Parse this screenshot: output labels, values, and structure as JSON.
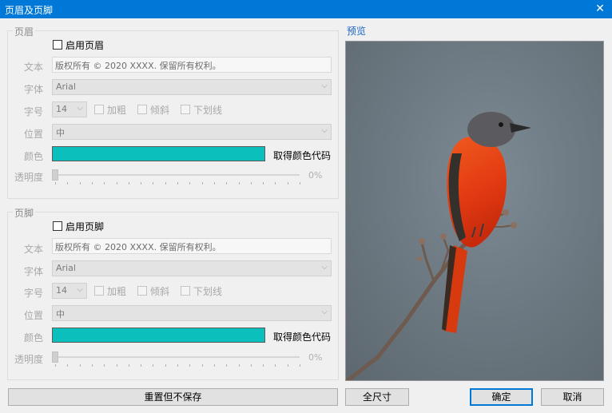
{
  "window": {
    "title": "页眉及页脚",
    "close_glyph": "✕"
  },
  "header": {
    "group_title": "页眉",
    "enable_label": "启用页眉",
    "text_label": "文本",
    "text_value": "版权所有 © 2020 XXXX. 保留所有权利。",
    "font_label": "字体",
    "font_value": "Arial",
    "size_label": "字号",
    "size_value": "14",
    "bold_label": "加粗",
    "italic_label": "倾斜",
    "underline_label": "下划线",
    "position_label": "位置",
    "position_value": "中",
    "color_label": "颜色",
    "color_value": "#0abfbc",
    "get_color_code": "取得颜色代码",
    "opacity_label": "透明度",
    "opacity_value": "0%",
    "opacity_fraction": 0
  },
  "footer": {
    "group_title": "页脚",
    "enable_label": "启用页脚",
    "text_label": "文本",
    "text_value": "版权所有 © 2020 XXXX. 保留所有权利。",
    "font_label": "字体",
    "font_value": "Arial",
    "size_label": "字号",
    "size_value": "14",
    "bold_label": "加粗",
    "italic_label": "倾斜",
    "underline_label": "下划线",
    "position_label": "位置",
    "position_value": "中",
    "color_label": "颜色",
    "color_value": "#0abfbc",
    "get_color_code": "取得颜色代码",
    "opacity_label": "透明度",
    "opacity_value": "0%",
    "opacity_fraction": 0
  },
  "preview": {
    "label": "预览"
  },
  "buttons": {
    "reset": "重置但不保存",
    "full_size": "全尺寸",
    "ok": "确定",
    "cancel": "取消"
  },
  "icons": {
    "dropdown": "chevron-down-icon",
    "close": "close-icon"
  }
}
